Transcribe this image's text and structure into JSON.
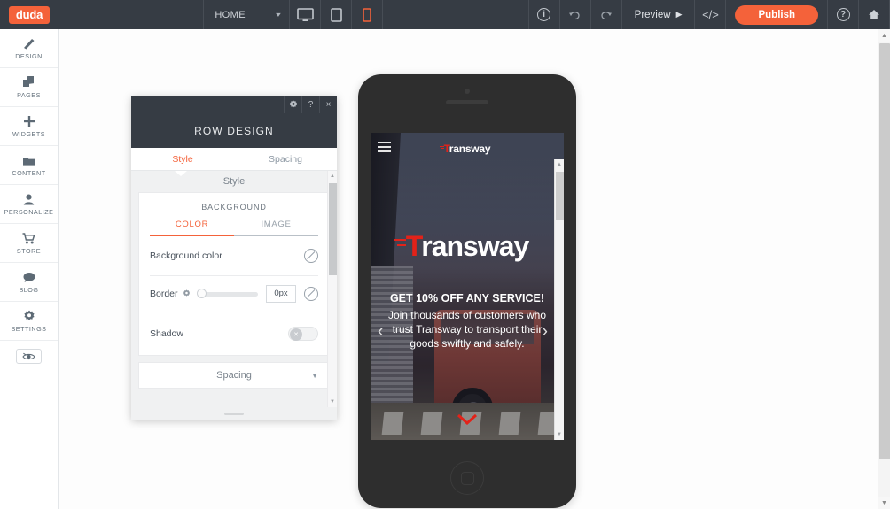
{
  "topbar": {
    "logo": "duda",
    "page_selector": {
      "value": "HOME",
      "caret": "chevron-down-icon"
    },
    "devices": [
      {
        "name": "desktop",
        "icon": "desktop-icon",
        "active": false
      },
      {
        "name": "tablet",
        "icon": "tablet-icon",
        "active": false
      },
      {
        "name": "mobile",
        "icon": "mobile-icon",
        "active": true
      }
    ],
    "info_icon": "info-icon",
    "undo_icon": "undo-icon",
    "redo_icon": "redo-icon",
    "preview_label": "Preview",
    "preview_icon": "play-icon",
    "code_icon": "code-icon",
    "publish_label": "Publish",
    "help_icon": "help-icon",
    "home_icon": "home-icon",
    "accent_color": "#f4623a",
    "bar_color": "#363c44"
  },
  "sidebar": {
    "items": [
      {
        "label": "DESIGN",
        "icon": "brush-icon"
      },
      {
        "label": "PAGES",
        "icon": "pages-icon"
      },
      {
        "label": "WIDGETS",
        "icon": "plus-icon"
      },
      {
        "label": "CONTENT",
        "icon": "folder-icon"
      },
      {
        "label": "PERSONALIZE",
        "icon": "person-icon"
      },
      {
        "label": "STORE",
        "icon": "cart-icon"
      },
      {
        "label": "BLOG",
        "icon": "comment-icon"
      },
      {
        "label": "SETTINGS",
        "icon": "gear-icon"
      }
    ],
    "preview_toggle_icon": "eye-slash-icon"
  },
  "panel": {
    "window_buttons": {
      "settings_icon": "gear-icon",
      "help_label": "?",
      "close_label": "×"
    },
    "title": "ROW DESIGN",
    "tabs": [
      {
        "label": "Style",
        "active": true
      },
      {
        "label": "Spacing",
        "active": false
      }
    ],
    "section_header": "Style",
    "background": {
      "title": "BACKGROUND",
      "tabs": [
        {
          "label": "COLOR",
          "active": true
        },
        {
          "label": "IMAGE",
          "active": false
        }
      ],
      "background_color": {
        "label": "Background color",
        "value": "none",
        "icon": "no-color-icon"
      }
    },
    "border": {
      "label": "Border",
      "gear_icon": "gear-icon",
      "slider_value": 0,
      "slider_min": 0,
      "slider_max": 20,
      "input_value": "0px",
      "reset_icon": "no-color-icon"
    },
    "shadow": {
      "label": "Shadow",
      "enabled": false,
      "knob_icon": "close-icon"
    },
    "spacing_collapse": {
      "label": "Spacing",
      "chevron": "chevron-down-icon"
    }
  },
  "preview": {
    "device": "mobile",
    "site": {
      "menu_icon": "hamburger-icon",
      "header_logo": "ransway",
      "hero_logo": "ransway",
      "headline": "GET 10% OFF ANY SERVICE!",
      "body": "Join thousands of customers who trust Transway to transport their goods swiftly and safely.",
      "prev_arrow": "‹",
      "next_arrow": "›",
      "scroll_down_icon": "chevron-down-icon",
      "logo_mark_color": "#e32219"
    }
  }
}
